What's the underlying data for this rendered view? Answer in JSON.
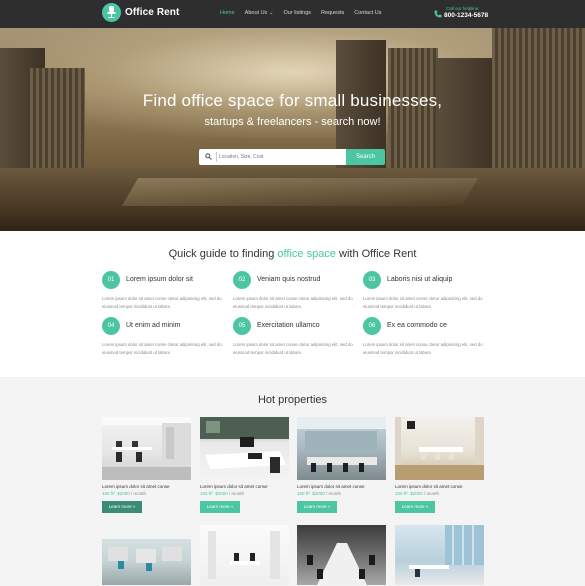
{
  "header": {
    "logo_text": "Office Rent",
    "nav": [
      {
        "label": "Home",
        "active": true
      },
      {
        "label": "About Us",
        "has_caret": true
      },
      {
        "label": "Our listings"
      },
      {
        "label": "Requests"
      },
      {
        "label": "Contact Us"
      }
    ],
    "help_label": "Call our helpline:",
    "help_phone": "800-1234-5678"
  },
  "hero": {
    "title": "Find office space for small businesses,",
    "subtitle": "startups & freelancers - search now!",
    "search_placeholder": "Location, Size, Cost",
    "search_button": "Search"
  },
  "guide": {
    "title_before": "Quick guide to finding ",
    "title_highlight": "office space",
    "title_after": " with Office Rent",
    "features": [
      {
        "num": "01",
        "title": "Lorem ipsum dolor sit",
        "desc": "Lorem ipsum dolor sit amet conse ctetur adipisicing elit, sed do eiusmod tempor incididunt ut labore."
      },
      {
        "num": "02",
        "title": "Veniam quis nostrud",
        "desc": "Lorem ipsum dolor sit amet conse ctetur adipisicing elit, sed do eiusmod tempor incididunt ut labore."
      },
      {
        "num": "03",
        "title": "Laboris nisi ut aliquip",
        "desc": "Lorem ipsum dolor sit amet conse ctetur adipisicing elit, sed do eiusmod tempor incididunt ut labore."
      },
      {
        "num": "04",
        "title": "Ut enim ad minim",
        "desc": "Lorem ipsum dolor sit amet conse ctetur adipisicing elit, sed do eiusmod tempor incididunt ut labore."
      },
      {
        "num": "05",
        "title": "Exercitation ullamco",
        "desc": "Lorem ipsum dolor sit amet conse ctetur adipisicing elit, sed do eiusmod tempor incididunt ut labore."
      },
      {
        "num": "06",
        "title": "Ex ea commodo ce",
        "desc": "Lorem ipsum dolor sit amet conse ctetur adipisicing elit, sed do eiusmod tempor incididunt ut labore."
      }
    ]
  },
  "hot": {
    "title": "Hot properties",
    "cards": [
      {
        "title": "Lorem ipsum dolor sit amet conse",
        "price": "150 ft²",
        "cost": "$2000",
        "per": " / month",
        "button": "Learn more »"
      },
      {
        "title": "Lorem ipsum dolor sit amet conse",
        "price": "150 ft²",
        "cost": "$2000",
        "per": " / month",
        "button": "Learn more »"
      },
      {
        "title": "Lorem ipsum dolor sit amet conse",
        "price": "150 ft²",
        "cost": "$2000",
        "per": " / month",
        "button": "Learn more »"
      },
      {
        "title": "Lorem ipsum dolor sit amet conse",
        "price": "150 ft²",
        "cost": "$2000",
        "per": " / month",
        "button": "Learn more »"
      }
    ]
  },
  "colors": {
    "accent": "#4cc6a2",
    "header_bg": "#2e2e2e",
    "section_bg": "#f4f4f4"
  }
}
